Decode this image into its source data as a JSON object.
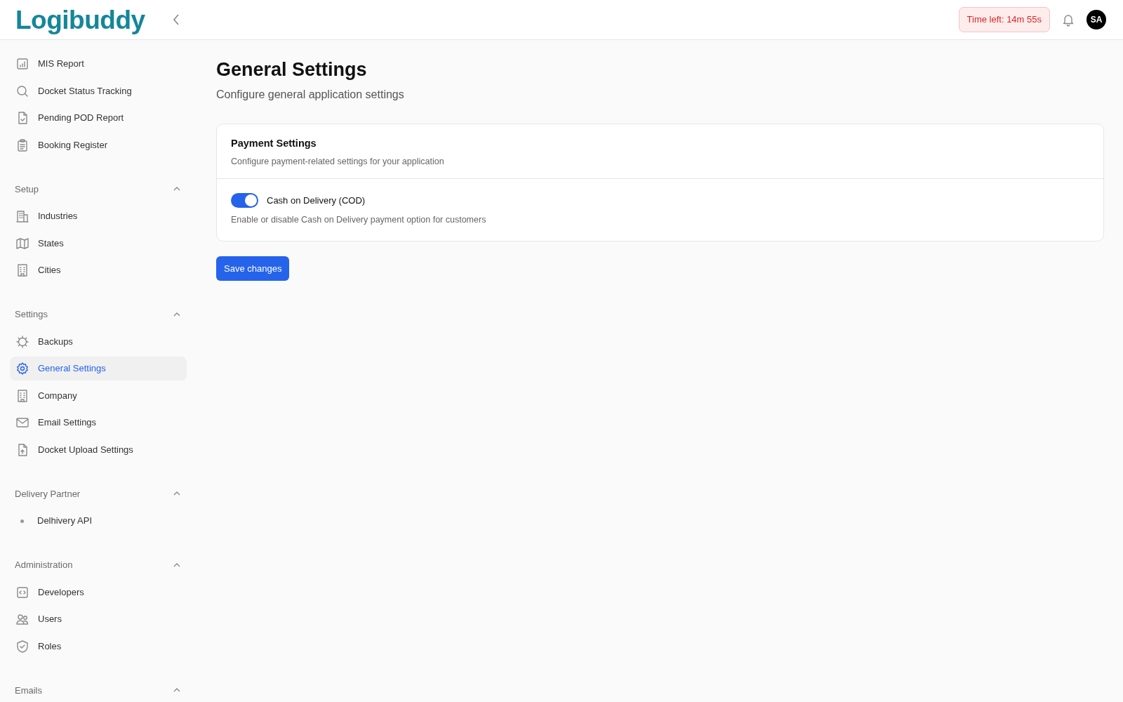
{
  "header": {
    "logo": "Logibuddy",
    "timer": "Time left: 14m 55s",
    "avatar": "SA"
  },
  "sidebar": {
    "sections": [
      {
        "items": [
          {
            "label": "MIS Report",
            "kind": "icon",
            "selected": false
          },
          {
            "label": "Docket Status Tracking",
            "kind": "icon",
            "selected": false
          },
          {
            "label": "Pending POD Report",
            "kind": "icon",
            "selected": false
          },
          {
            "label": "Booking Register",
            "kind": "icon",
            "selected": false
          }
        ]
      },
      {
        "title": "Setup",
        "expanded": true,
        "items": [
          {
            "label": "Industries",
            "kind": "icon",
            "selected": false
          },
          {
            "label": "States",
            "kind": "icon",
            "selected": false
          },
          {
            "label": "Cities",
            "kind": "icon",
            "selected": false
          }
        ]
      },
      {
        "title": "Settings",
        "expanded": true,
        "items": [
          {
            "label": "Backups",
            "kind": "icon",
            "selected": false
          },
          {
            "label": "General Settings",
            "kind": "icon",
            "selected": true
          },
          {
            "label": "Company",
            "kind": "icon",
            "selected": false
          },
          {
            "label": "Email Settings",
            "kind": "icon",
            "selected": false
          },
          {
            "label": "Docket Upload Settings",
            "kind": "icon",
            "selected": false
          }
        ]
      },
      {
        "title": "Delivery Partner",
        "expanded": true,
        "items": [
          {
            "label": "Delhivery API",
            "kind": "dot",
            "selected": false
          }
        ]
      },
      {
        "title": "Administration",
        "expanded": true,
        "items": [
          {
            "label": "Developers",
            "kind": "icon",
            "selected": false
          },
          {
            "label": "Users",
            "kind": "icon",
            "selected": false
          },
          {
            "label": "Roles",
            "kind": "icon",
            "selected": false
          }
        ]
      },
      {
        "title": "Emails",
        "expanded": true
      }
    ]
  },
  "page": {
    "title": "General Settings",
    "subtitle": "Configure general application settings"
  },
  "card": {
    "title": "Payment Settings",
    "description": "Configure payment-related settings for your application",
    "setting": {
      "label": "Cash on Delivery (COD)",
      "on": true,
      "help": "Enable or disable Cash on Delivery payment option for customers"
    }
  },
  "save_button": "Save changes"
}
